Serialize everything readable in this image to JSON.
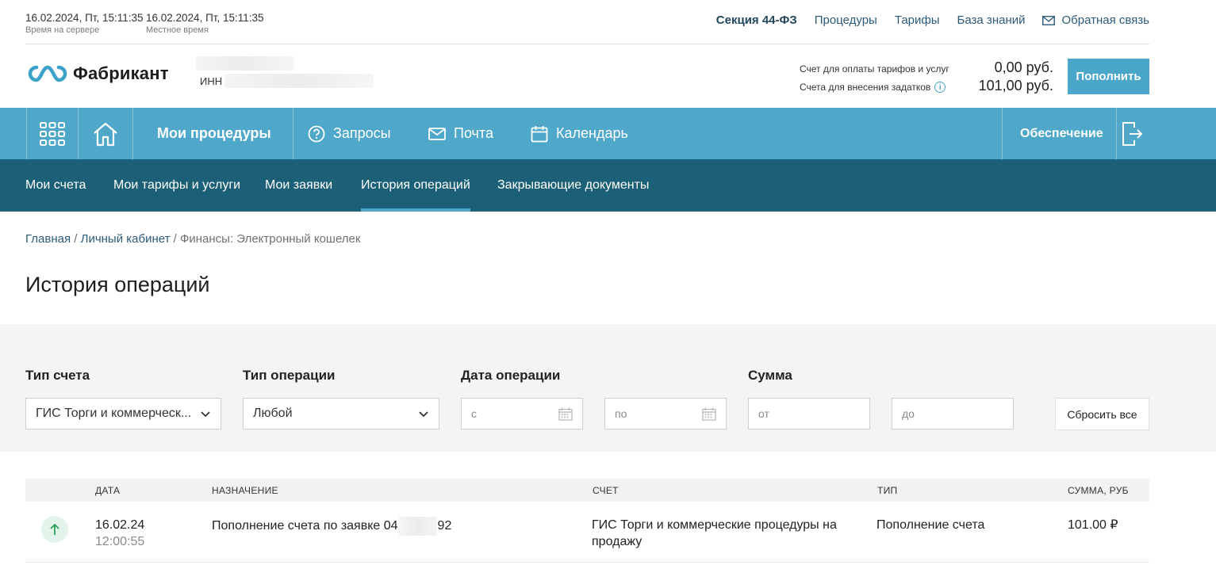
{
  "topbar": {
    "server_time": "16.02.2024, Пт, 15:11:35",
    "server_time_label": "Время на сервере",
    "local_time": "16.02.2024, Пт, 15:11:35",
    "local_time_label": "Местное время",
    "links": {
      "section": "Секция 44-ФЗ",
      "procedures": "Процедуры",
      "tariffs": "Тарифы",
      "knowledge": "База знаний",
      "feedback": "Обратная связь"
    }
  },
  "header": {
    "logo_text": "Фабрикант",
    "inn_label": "ИНН",
    "accounts": [
      {
        "label": "Счет для оплаты тарифов и услуг",
        "value": "0,00 руб."
      },
      {
        "label": "Счета для внесения задатков",
        "value": "101,00 руб."
      }
    ],
    "topup_label": "Пополнить"
  },
  "main_nav": {
    "my_procedures": "Мои процедуры",
    "requests": "Запросы",
    "mail": "Почта",
    "calendar": "Календарь",
    "security": "Обеспечение"
  },
  "sub_nav": {
    "items": [
      "Мои счета",
      "Мои тарифы и услуги",
      "Мои заявки",
      "История операций",
      "Закрывающие документы"
    ],
    "active": "История операций"
  },
  "breadcrumb": {
    "home": "Главная",
    "sep1": " / ",
    "cabinet": "Личный кабинет",
    "sep2": " / ",
    "current": "Финансы: Электронный кошелек"
  },
  "page_title": "История операций",
  "filters": {
    "account_type_label": "Тип счета",
    "account_type_value": "ГИС Торги и коммерческ...",
    "operation_type_label": "Тип операции",
    "operation_type_value": "Любой",
    "date_label": "Дата операции",
    "date_from_placeholder": "с",
    "date_to_placeholder": "по",
    "amount_label": "Сумма",
    "amount_from_placeholder": "от",
    "amount_to_placeholder": "до",
    "reset_label": "Сбросить все"
  },
  "table": {
    "headers": {
      "date": "ДАТА",
      "purpose": "НАЗНАЧЕНИЕ",
      "account": "СЧЕТ",
      "type": "ТИП",
      "amount": "СУММА, РУБ"
    },
    "rows": [
      {
        "date": "16.02.24",
        "time": "12:00:55",
        "purpose_prefix": "Пополнение счета по заявке 04",
        "purpose_suffix": "92",
        "account": "ГИС Торги и коммерческие процедуры на продажу",
        "type": "Пополнение счета",
        "amount": "101.00 ₽",
        "direction": "incoming",
        "icon_color": "#2e9e56"
      }
    ]
  },
  "colors": {
    "nav_primary": "#4fa8ca",
    "nav_secondary": "#1b6076",
    "button": "#4aa7c9"
  }
}
